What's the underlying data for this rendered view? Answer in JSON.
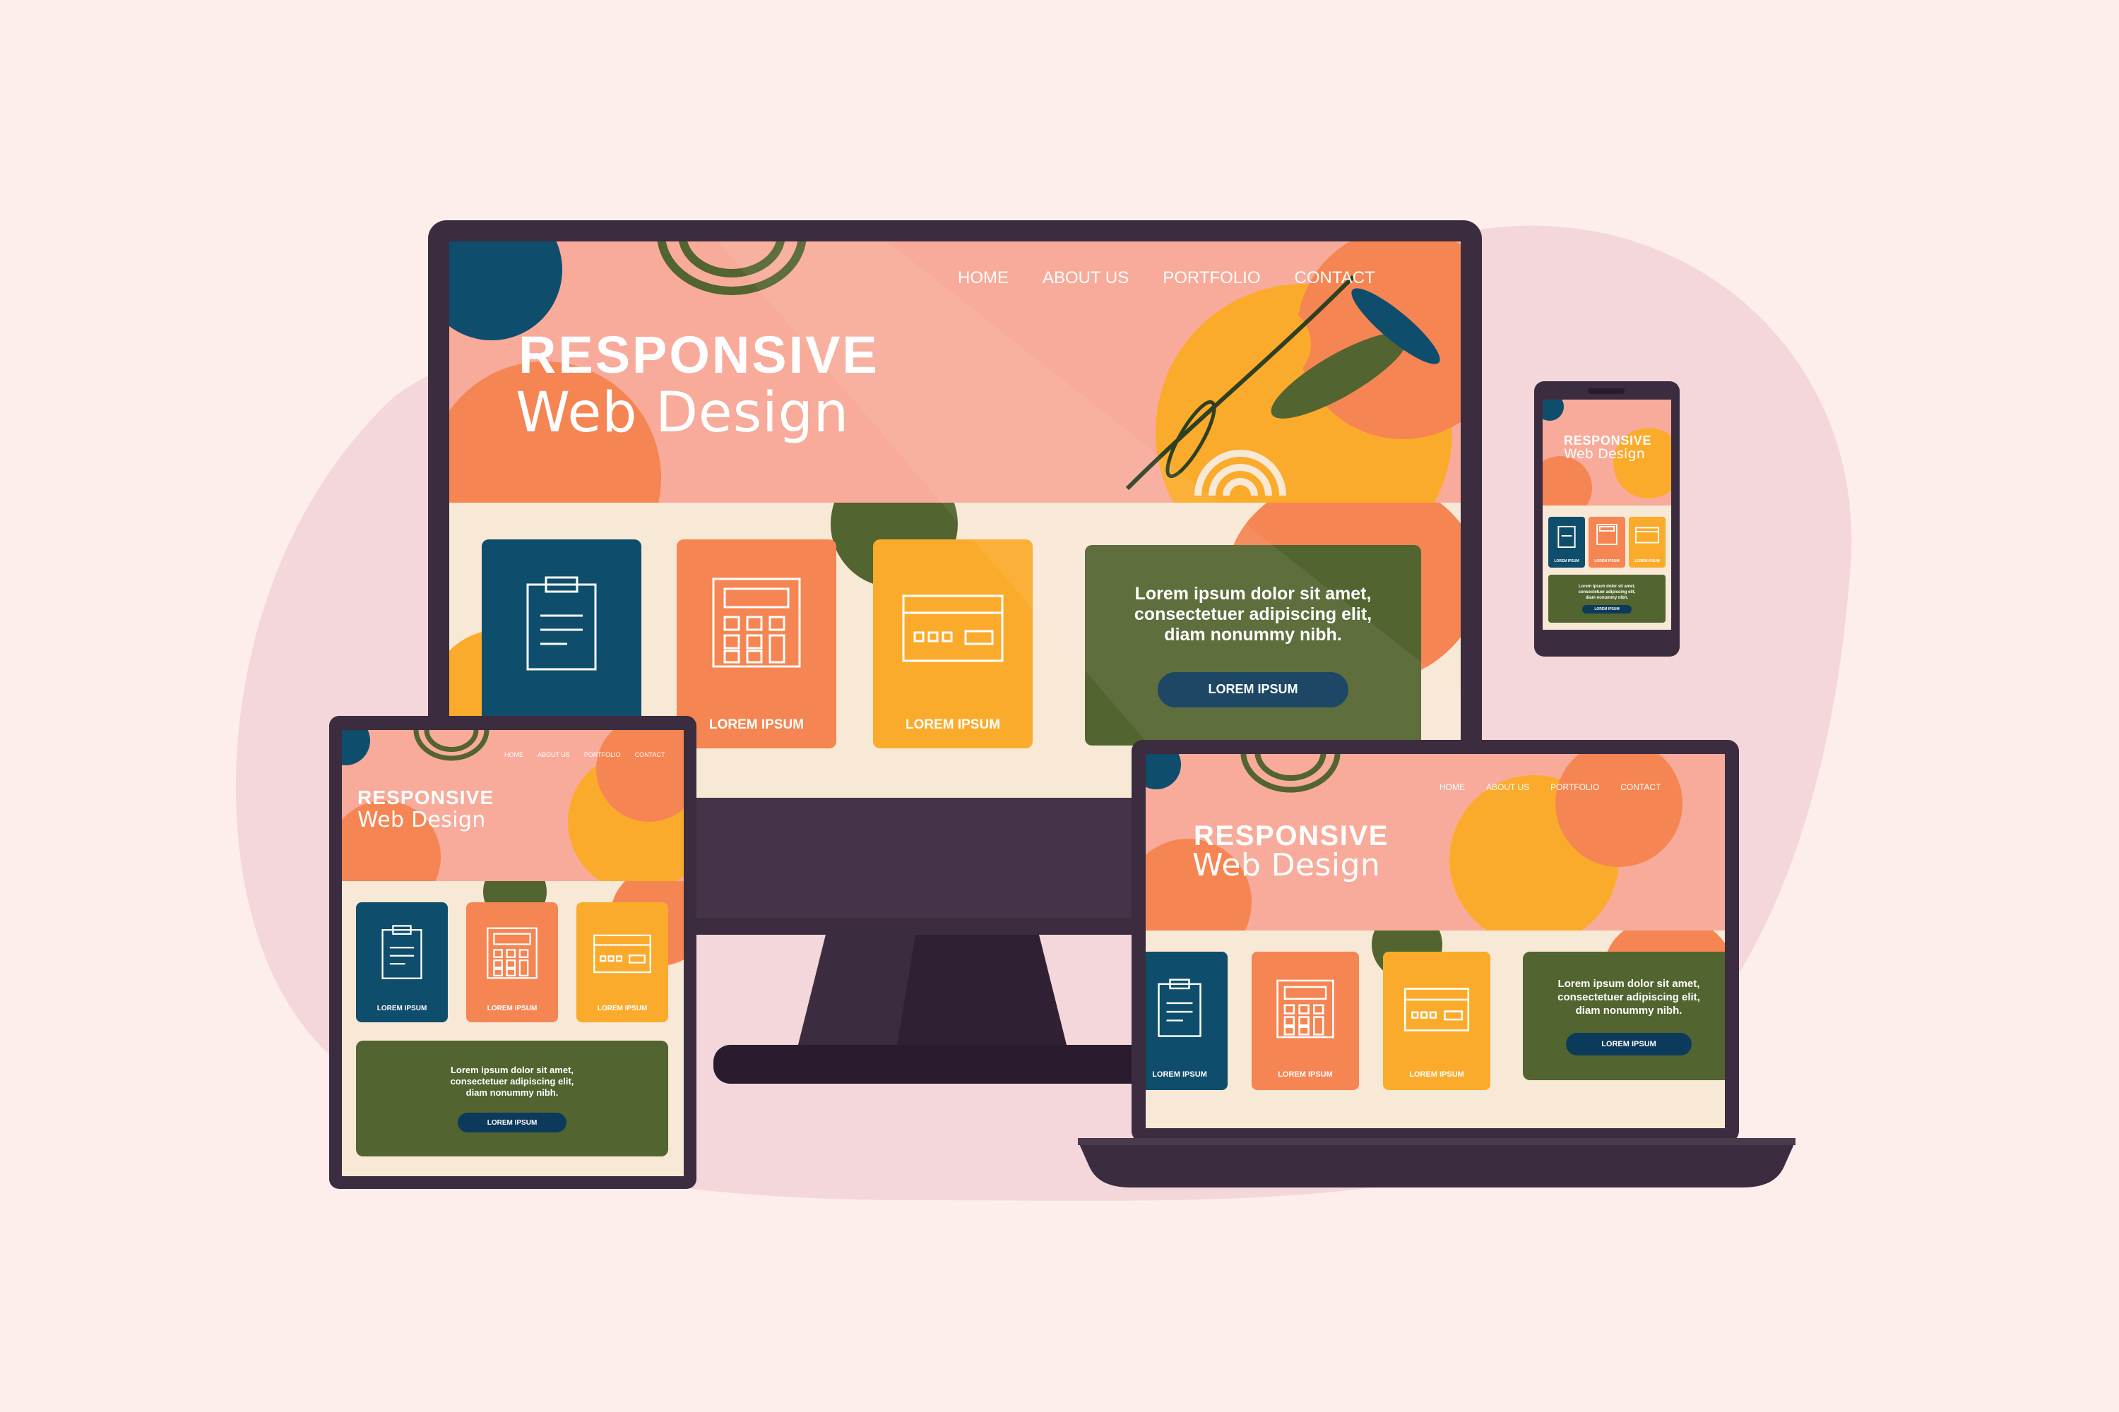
{
  "colors": {
    "background": "#fdeeeb",
    "blob": "#f4d7da",
    "frame": "#3c2c3f",
    "hero_pink": "#f8ab9a",
    "card_blue": "#0f4d6c",
    "card_orange": "#f58552",
    "card_yellow": "#fbab2c",
    "panel_green": "#52642f",
    "button_navy": "#0c3a5a"
  },
  "hero": {
    "title_bold": "RESPONSIVE",
    "title_light": "Web Design"
  },
  "nav": {
    "items": [
      "HOME",
      "ABOUT US",
      "PORTFOLIO",
      "CONTACT"
    ]
  },
  "cards": [
    {
      "label": "LOREM IPSUM",
      "icon": "clipboard-icon"
    },
    {
      "label": "LOREM IPSUM",
      "icon": "calculator-icon"
    },
    {
      "label": "LOREM IPSUM",
      "icon": "credit-card-icon"
    }
  ],
  "info_panel": {
    "text": "Lorem ipsum dolor sit amet,\nconsectetuer adipiscing elit,\ndiam nonummy nibh.",
    "button_label": "LOREM IPSUM"
  },
  "devices": [
    "desktop-monitor",
    "tablet",
    "laptop",
    "smartphone"
  ]
}
